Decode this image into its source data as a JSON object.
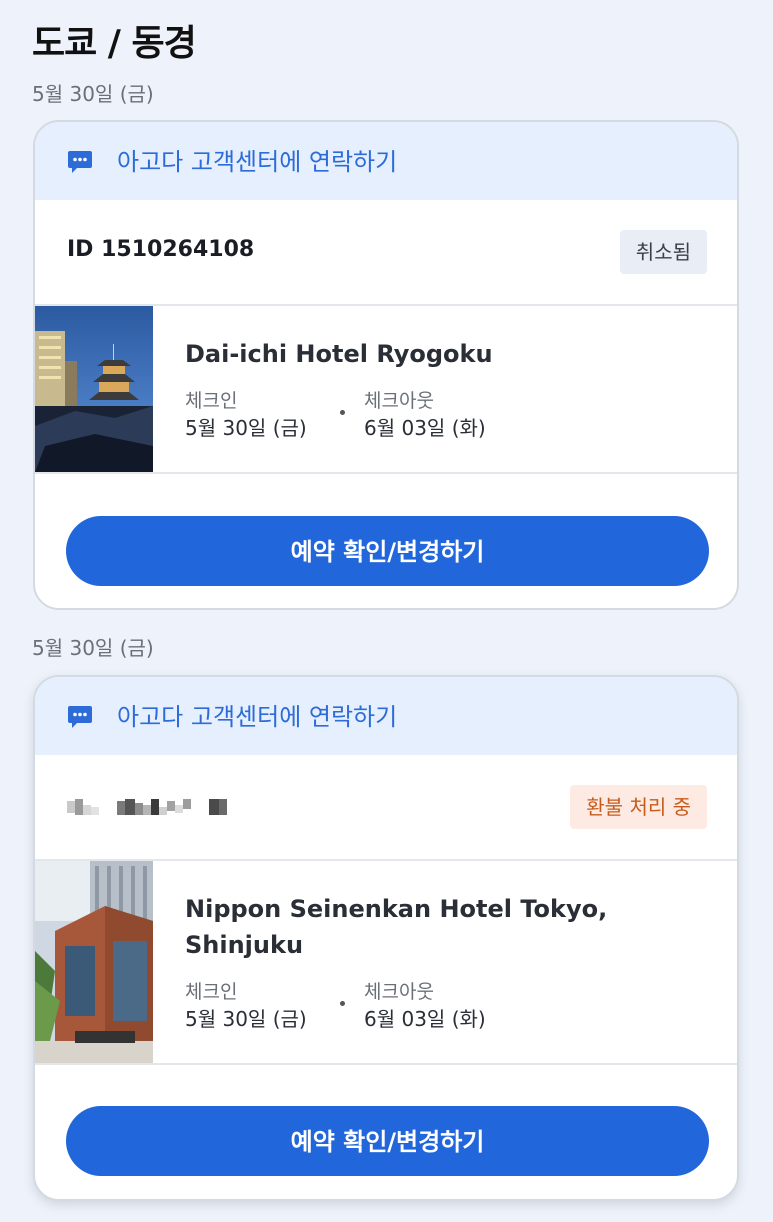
{
  "header": {
    "title": "도쿄 / 동경"
  },
  "colors": {
    "accent": "#2166db",
    "contact_bg": "#e5effd",
    "contact_text": "#2d6cd8",
    "cancelled_badge_bg": "#e8edf6",
    "refund_badge_bg": "#fdebe3",
    "refund_badge_text": "#c85b1c"
  },
  "bookings": [
    {
      "date_label": "5월 30일 (금)",
      "contact_label": "아고다 고객센터에 연락하기",
      "contact_icon": "chat-icon",
      "booking_id": "ID 1510264108",
      "status": "취소됨",
      "hotel_name": "Dai-ichi Hotel Ryogoku",
      "checkin_label": "체크인",
      "checkin_date": "5월 30일 (금)",
      "checkout_label": "체크아웃",
      "checkout_date": "6월 03일 (화)",
      "action_label": "예약 확인/변경하기"
    },
    {
      "date_label": "5월 30일 (금)",
      "contact_label": "아고다 고객센터에 연락하기",
      "contact_icon": "chat-icon",
      "status": "환불 처리 중",
      "hotel_name": "Nippon Seinenkan Hotel Tokyo, Shinjuku",
      "checkin_label": "체크인",
      "checkin_date": "5월 30일 (금)",
      "checkout_label": "체크아웃",
      "checkout_date": "6월 03일 (화)",
      "action_label": "예약 확인/변경하기"
    }
  ]
}
